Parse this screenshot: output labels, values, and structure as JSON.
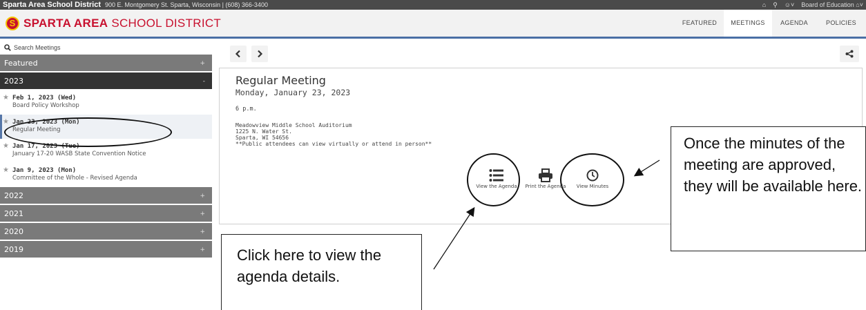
{
  "topbar": {
    "district_name": "Sparta Area School District",
    "address": "900 E. Montgomery St. Sparta, Wisconsin | (608) 366-3400",
    "board_label": "Board of Education"
  },
  "brand": {
    "logo_letter": "S",
    "name_bold": "SPARTA AREA",
    "name_thin": "SCHOOL DISTRICT"
  },
  "nav": {
    "tabs": [
      {
        "label": "FEATURED"
      },
      {
        "label": "MEETINGS"
      },
      {
        "label": "AGENDA"
      },
      {
        "label": "POLICIES"
      }
    ],
    "active_tab": "MEETINGS"
  },
  "sidebar": {
    "search_placeholder": "Search Meetings",
    "sections": {
      "featured": {
        "label": "Featured",
        "toggle": "+"
      },
      "y2023": {
        "label": "2023",
        "toggle": "-"
      },
      "y2022": {
        "label": "2022",
        "toggle": "+"
      },
      "y2021": {
        "label": "2021",
        "toggle": "+"
      },
      "y2020": {
        "label": "2020",
        "toggle": "+"
      },
      "y2019": {
        "label": "2019",
        "toggle": "+"
      }
    },
    "meetings": [
      {
        "date": "Feb 1, 2023 (Wed)",
        "title": "Board Policy Workshop"
      },
      {
        "date": "Jan 23, 2023 (Mon)",
        "title": "Regular Meeting"
      },
      {
        "date": "Jan 17, 2023 (Tue)",
        "title": "January 17-20 WASB State Convention Notice"
      },
      {
        "date": "Jan 9, 2023 (Mon)",
        "title": "Committee of the Whole - Revised Agenda"
      }
    ]
  },
  "meeting": {
    "title": "Regular Meeting",
    "date": "Monday, January 23, 2023",
    "time": "6 p.m.",
    "location_lines": [
      "Meadowview Middle School Auditorium",
      "1225 N. Water St.",
      "Sparta, WI 54656",
      "**Public attendees can view virtually or attend in person**"
    ]
  },
  "actions": {
    "view_agenda": "View the Agenda",
    "print_agenda": "Print the Agenda",
    "view_minutes": "View Minutes"
  },
  "annotations": {
    "minutes_note": "Once the minutes of the meeting are approved, they will be available here.",
    "agenda_note": "Click here to view the agenda details."
  },
  "colors": {
    "brand_red": "#c8102e",
    "brand_gold": "#f5c400",
    "topbar": "#4a4a4a",
    "sidebar_grey": "#7a7a7a",
    "sidebar_dark": "#333333",
    "accent_blue": "#4a6fa5"
  }
}
